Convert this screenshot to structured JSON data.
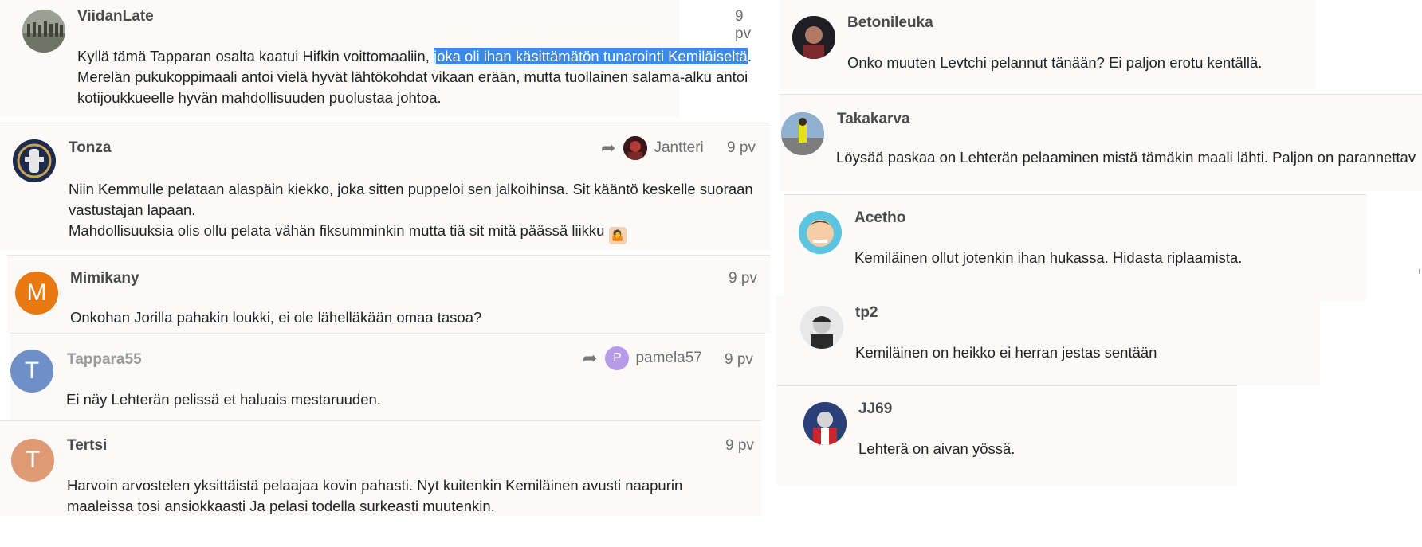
{
  "posts_left": [
    {
      "username": "ViidanLate",
      "date": "9 pv",
      "body_before": "Kyllä tämä Tapparan osalta kaatui Hifkin voittomaaliin, ",
      "body_selected": "joka oli ihan käsittämätön tunarointi Kemiläiseltä",
      "body_after": ". Merelän pukukoppimaali antoi vielä hyvät lähtökohdat vikaan erään, mutta tuollainen salama-alku antoi kotijoukkueelle hyvän mahdollisuuden puolustaa johtoa."
    },
    {
      "username": "Tonza",
      "date": "9 pv",
      "reply_to": "Jantteri",
      "body_line1": "Niin Kemmulle pelataan alaspäin kiekko, joka sitten puppeloi sen jalkoihinsa. Sit kääntö keskelle suoraan vastustajan lapaan.",
      "body_line2": "Mahdollisuuksia olis ollu pelata vähän fiksumminkin mutta tiä sit mitä päässä liikku"
    },
    {
      "username": "Mimikany",
      "avatar_letter": "M",
      "date": "9 pv",
      "body": "Onkohan Jorilla pahakin loukki, ei ole lähelläkään omaa tasoa?"
    },
    {
      "username": "Tappara55",
      "avatar_letter": "T",
      "date": "9 pv",
      "reply_to": "pamela57",
      "reply_avatar_letter": "P",
      "body": "Ei näy Lehterän pelissä et haluais mestaruuden."
    },
    {
      "username": "Tertsi",
      "avatar_letter": "T",
      "date": "9 pv",
      "body": "Harvoin arvostelen yksittäistä pelaajaa kovin pahasti. Nyt kuitenkin Kemiläinen avusti naapurin maaleissa tosi ansiokkaasti Ja pelasi todella surkeasti muutenkin."
    }
  ],
  "posts_right": [
    {
      "username": "Betonileuka",
      "body": "Onko muuten Levtchi pelannut tänään? Ei paljon erotu kentällä."
    },
    {
      "username": "Takakarva",
      "body": "Löysää paskaa on Lehterän pelaaminen mistä tämäkin maali lähti. Paljon on parannettav"
    },
    {
      "username": "Acetho",
      "body": "Kemiläinen ollut jotenkin ihan hukassa. Hidasta riplaamista."
    },
    {
      "username": "tp2",
      "body": "Kemiläinen on heikko ei herran jestas sentään"
    },
    {
      "username": "JJ69",
      "body": "Lehterä on aivan yössä."
    }
  ],
  "colors": {
    "mimikany": "#e8780f",
    "tappara55": "#6e8fc7",
    "tertsi": "#e09a73",
    "pamela57": "#b79ae8",
    "selection": "#3c8ae8"
  },
  "icons": [
    "reply-arrow-icon",
    "shrug-emoji-icon"
  ]
}
